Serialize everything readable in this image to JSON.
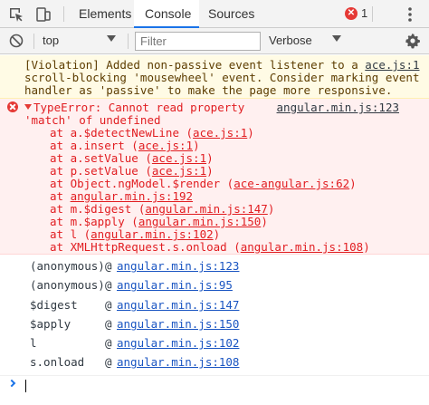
{
  "tabs": [
    "Elements",
    "Console",
    "Sources"
  ],
  "error_count": "1",
  "toolbar": {
    "context": "top",
    "filter_placeholder": "Filter",
    "level": "Verbose"
  },
  "warning": {
    "line1_text": "[Violation] Added non-passive event listener to a ",
    "line1_link": "ace.js:1",
    "line2": "scroll-blocking 'mousewheel' event. Consider marking event",
    "line3": "handler as 'passive' to make the page more responsive."
  },
  "error": {
    "line1": "TypeError: Cannot read property",
    "source": "angular.min.js:123",
    "line2": "'match' of undefined",
    "frames": [
      {
        "pre": "at a.$detectNewLine (",
        "link": "ace.js:1",
        "post": ")"
      },
      {
        "pre": "at a.insert (",
        "link": "ace.js:1",
        "post": ")"
      },
      {
        "pre": "at a.setValue (",
        "link": "ace.js:1",
        "post": ")"
      },
      {
        "pre": "at p.setValue (",
        "link": "ace.js:1",
        "post": ")"
      },
      {
        "pre": "at Object.ngModel.$render (",
        "link": "ace-angular.js:62",
        "post": ")"
      },
      {
        "pre": "at ",
        "link": "angular.min.js:192",
        "post": ""
      },
      {
        "pre": "at m.$digest (",
        "link": "angular.min.js:147",
        "post": ")"
      },
      {
        "pre": "at m.$apply (",
        "link": "angular.min.js:150",
        "post": ")"
      },
      {
        "pre": "at l (",
        "link": "angular.min.js:102",
        "post": ")"
      },
      {
        "pre": "at XMLHttpRequest.s.onload (",
        "link": "angular.min.js:108",
        "post": ")"
      }
    ]
  },
  "stack": [
    {
      "name": "(anonymous)",
      "at": "@",
      "link": "angular.min.js:123"
    },
    {
      "name": "(anonymous)",
      "at": "@",
      "link": "angular.min.js:95"
    },
    {
      "name": "$digest",
      "at": "@",
      "link": "angular.min.js:147"
    },
    {
      "name": "$apply",
      "at": "@",
      "link": "angular.min.js:150"
    },
    {
      "name": "l",
      "at": "@",
      "link": "angular.min.js:102"
    },
    {
      "name": "s.onload",
      "at": "@",
      "link": "angular.min.js:108"
    }
  ],
  "colors": {
    "error": "#e11d21",
    "link": "#1a55c2",
    "warning_bg": "#fffbe5",
    "error_bg": "#fff0f0",
    "accent": "#1a73e8"
  },
  "icons": [
    "inspect-icon",
    "device-toolbar-icon",
    "error-icon",
    "menu-icon",
    "clear-console-icon",
    "dropdown-icon",
    "settings-icon",
    "prompt-chevron-icon"
  ]
}
